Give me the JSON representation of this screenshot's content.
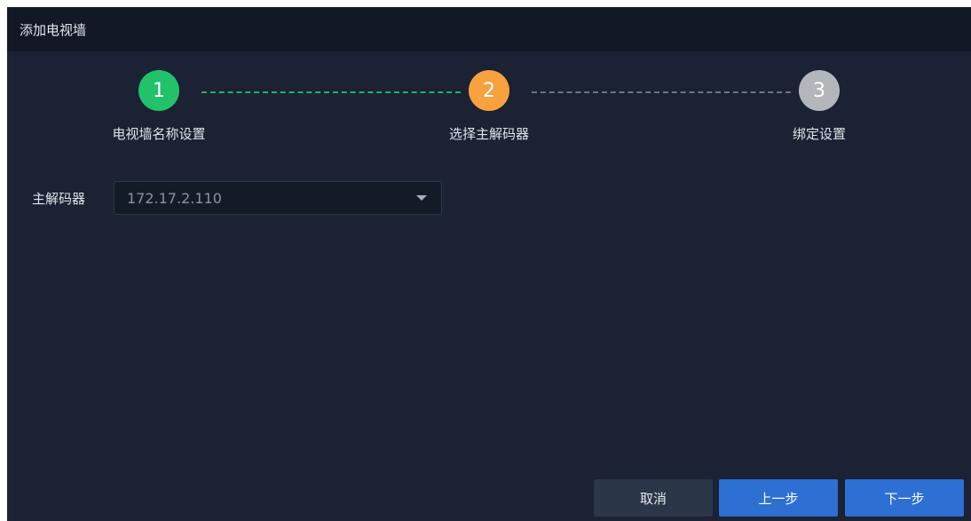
{
  "dialog": {
    "title": "添加电视墙"
  },
  "stepper": {
    "steps": [
      {
        "number": "1",
        "label": "电视墙名称设置",
        "state": "done",
        "color": "#22c26b"
      },
      {
        "number": "2",
        "label": "选择主解码器",
        "state": "active",
        "color": "#f7a23e"
      },
      {
        "number": "3",
        "label": "绑定设置",
        "state": "pending",
        "color": "#b3b6bb"
      }
    ]
  },
  "form": {
    "decoder_label": "主解码器",
    "decoder_value": "172.17.2.110"
  },
  "buttons": {
    "cancel": "取消",
    "previous": "上一步",
    "next": "下一步"
  },
  "colors": {
    "background": "#1a2233",
    "titlebar": "#121826",
    "primary_button": "#2d6fd3",
    "completed_line": "#23b26d",
    "pending_line": "#6b7686"
  }
}
